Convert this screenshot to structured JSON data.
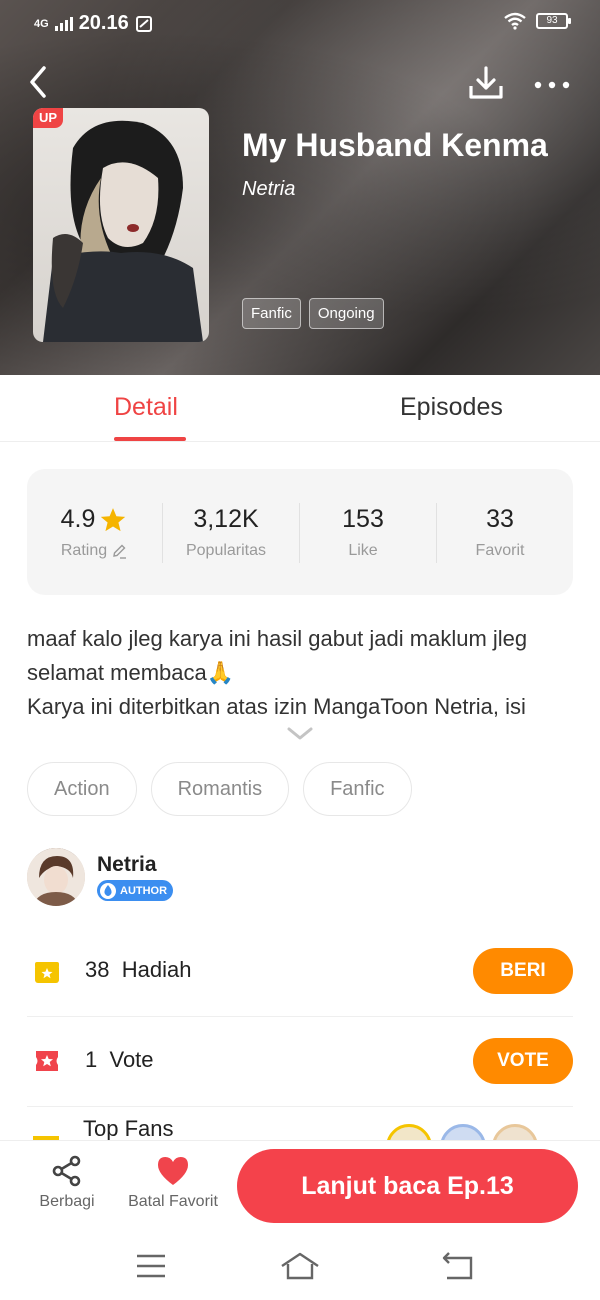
{
  "status_bar": {
    "network": "4G",
    "time": "20.16",
    "battery": "93"
  },
  "book": {
    "title": "My Husband Kenma",
    "author": "Netria",
    "cover_badge": "UP",
    "tags": [
      "Fanfic",
      "Ongoing"
    ]
  },
  "tabs": {
    "detail": "Detail",
    "episodes": "Episodes"
  },
  "stats": {
    "rating_value": "4.9",
    "rating_label": "Rating",
    "popularity_value": "3,12K",
    "popularity_label": "Popularitas",
    "like_value": "153",
    "like_label": "Like",
    "favorite_value": "33",
    "favorite_label": "Favorit"
  },
  "description": {
    "line1": "maaf kalo jleg karya ini hasil gabut jadi maklum jleg",
    "line2": "selamat membaca🙏",
    "line3": "Karya ini diterbitkan atas izin MangaToon Netria, isi"
  },
  "genres": [
    "Action",
    "Romantis",
    "Fanfic"
  ],
  "author_section": {
    "name": "Netria",
    "badge": "AUTHOR"
  },
  "gift_row": {
    "count": "38",
    "label": "Hadiah",
    "button": "BERI"
  },
  "vote_row": {
    "count": "1",
    "label": "Vote",
    "button": "VOTE"
  },
  "top_fans": {
    "label": "Top Fans"
  },
  "bottom_bar": {
    "share": "Berbagi",
    "favorite": "Batal Favorit",
    "continue": "Lanjut baca Ep.13"
  },
  "colors": {
    "accent": "#ef4444",
    "orange_button": "#ff8a00",
    "cta": "#f4424b",
    "author_badge": "#3b8ef0",
    "star": "#f5b400"
  }
}
